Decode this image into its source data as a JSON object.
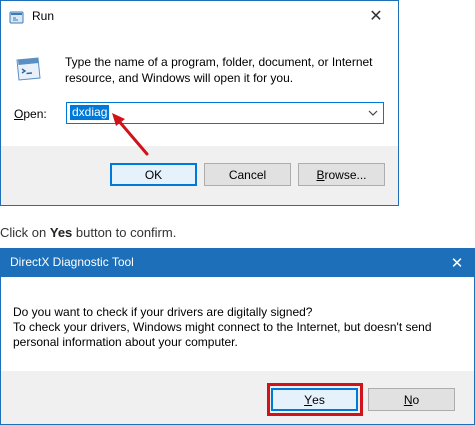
{
  "run_dialog": {
    "title": "Run",
    "close_glyph": "✕",
    "instructions": "Type the name of a program, folder, document, or Internet resource, and Windows will open it for you.",
    "open_label_mnemonic": "O",
    "open_label_rest": "pen:",
    "open_value": "dxdiag",
    "buttons": {
      "ok": "OK",
      "cancel": "Cancel",
      "browse_mnemonic": "B",
      "browse_rest": "rowse..."
    },
    "icons": [
      "run-app-icon",
      "run-large-icon",
      "chevron-down-icon",
      "close-icon"
    ]
  },
  "annotation": {
    "arrow_color": "#d0121b",
    "highlight_color": "#d0121b"
  },
  "caption": {
    "prefix": "Click on ",
    "emphasis": "Yes",
    "suffix": " button to confirm."
  },
  "dx_dialog": {
    "title": "DirectX Diagnostic Tool",
    "close_glyph": "✕",
    "line1": "Do you want to check if your drivers are digitally signed?",
    "line2": "To check your drivers, Windows might connect to the Internet, but doesn't send personal information about your computer.",
    "buttons": {
      "yes_mnemonic": "Y",
      "yes_rest": "es",
      "no_mnemonic": "N",
      "no_rest": "o"
    }
  },
  "colors": {
    "accent": "#0078d7",
    "titlebar_blue": "#1c6fb8",
    "footer_gray": "#f0f0f0"
  }
}
